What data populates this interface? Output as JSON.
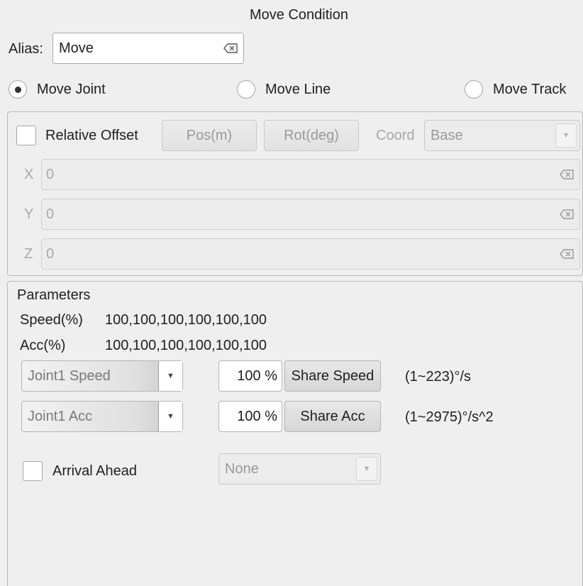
{
  "title": "Move Condition",
  "alias": {
    "label": "Alias:",
    "value": "Move"
  },
  "move_type": {
    "options": [
      "Move Joint",
      "Move Line",
      "Move Track"
    ],
    "selected": "Move Joint"
  },
  "offset": {
    "checkbox_label": "Relative Offset",
    "checked": false,
    "pos_button": "Pos(m)",
    "rot_button": "Rot(deg)",
    "coord_label": "Coord",
    "coord_value": "Base",
    "fields": [
      {
        "axis": "X",
        "value": "0"
      },
      {
        "axis": "Y",
        "value": "0"
      },
      {
        "axis": "Z",
        "value": "0"
      }
    ]
  },
  "parameters": {
    "heading": "Parameters",
    "speed_label": "Speed(%)",
    "speed_values": "100,100,100,100,100,100",
    "acc_label": "Acc(%)",
    "acc_values": "100,100,100,100,100,100",
    "speed_row": {
      "combo": "Joint1 Speed",
      "percent": "100 %",
      "button": "Share Speed",
      "range": "(1~223)°/s"
    },
    "acc_row": {
      "combo": "Joint1 Acc",
      "percent": "100 %",
      "button": "Share Acc",
      "range": "(1~2975)°/s^2"
    }
  },
  "arrival": {
    "checkbox_label": "Arrival Ahead",
    "checked": false,
    "combo_value": "None"
  },
  "icons": {
    "clear": "clear-text-icon",
    "dropdown": "chevron-down-icon"
  }
}
